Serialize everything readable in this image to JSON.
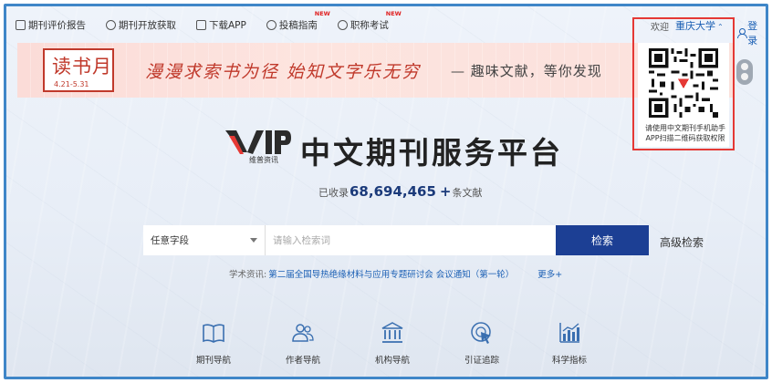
{
  "topnav": {
    "items": [
      {
        "label": "期刊评价报告",
        "icon": "report-icon",
        "new": ""
      },
      {
        "label": "期刊开放获取",
        "icon": "clock-icon",
        "new": ""
      },
      {
        "label": "下载APP",
        "icon": "download-icon",
        "new": ""
      },
      {
        "label": "投稿指南",
        "icon": "compass-icon",
        "new": "NEW"
      },
      {
        "label": "职称考试",
        "icon": "grad-cap-icon",
        "new": "NEW"
      }
    ]
  },
  "user": {
    "welcome": "欢迎",
    "institution": "重庆大学",
    "login": "登录"
  },
  "banner": {
    "stamp_title": "读书月",
    "stamp_date": "4.21-5.31",
    "slogan1": "漫漫求索书为径  始知文字乐无穷",
    "slogan2": "—  趣味文献，等你发现"
  },
  "qr": {
    "text": "请使用中文期刊手机助手APP扫描二维码获取权限"
  },
  "logo": {
    "brand": "VIP",
    "sub": "维普资讯"
  },
  "title": "中文期刊服务平台",
  "stats": {
    "prefix": "已收录",
    "count": "68,694,465",
    "plus": "+",
    "suffix": "条文献"
  },
  "search": {
    "field_selected": "任意字段",
    "placeholder": "请输入检索词",
    "button": "检索",
    "advanced": "高级检索"
  },
  "news": {
    "label": "学术资讯:",
    "link": "第二届全国导热绝缘材料与应用专题研讨会 会议通知（第一轮）",
    "more": "更多+"
  },
  "nav": [
    {
      "label": "期刊导航",
      "icon": "book-icon"
    },
    {
      "label": "作者导航",
      "icon": "people-icon"
    },
    {
      "label": "机构导航",
      "icon": "institution-icon"
    },
    {
      "label": "引证追踪",
      "icon": "cursor-target-icon"
    },
    {
      "label": "科学指标",
      "icon": "chart-icon"
    }
  ],
  "colors": {
    "frame": "#3f86c8",
    "accent_blue": "#1c3f94",
    "link_blue": "#1a5fb4",
    "highlight_red": "#e53935"
  }
}
